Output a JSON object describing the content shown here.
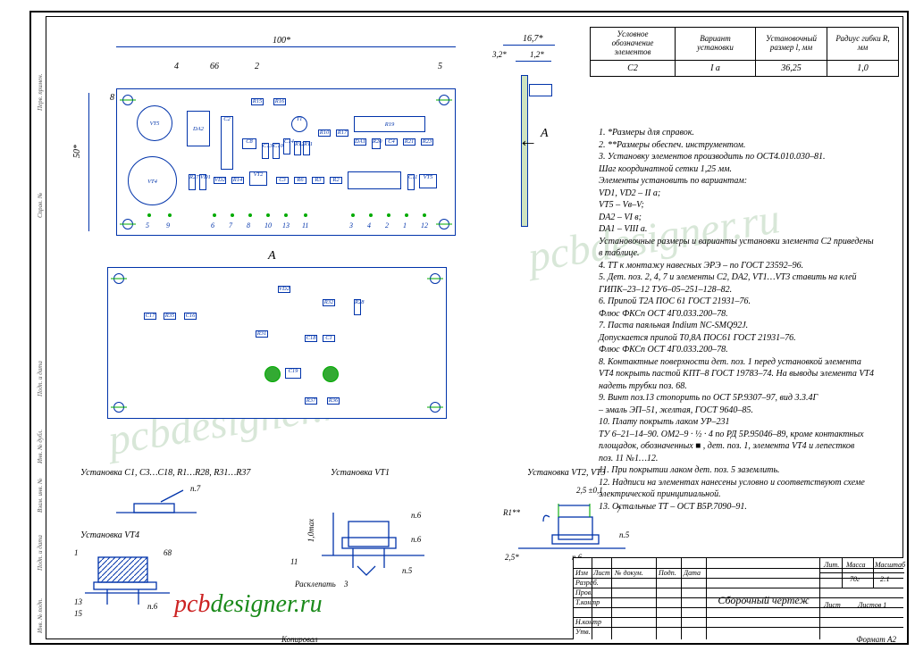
{
  "table": {
    "headers": [
      "Условное обозначение элементов",
      "Вариант установки",
      "Установочный размер l, мм",
      "Радиус гибки R, мм"
    ],
    "row": [
      "C2",
      "I а",
      "36,25",
      "1,0"
    ]
  },
  "dims": {
    "width": "100*",
    "height": "50*",
    "side_w": "16,7*",
    "side_gap": "1,2*",
    "side_t": "3,2*",
    "section": "А",
    "section_full": "А"
  },
  "callouts": {
    "c4": "4",
    "c66": "66",
    "c2": "2",
    "c5": "5",
    "c8": "8"
  },
  "pads_row": [
    "5",
    "9",
    "6",
    "7",
    "8",
    "10",
    "13",
    "11",
    "3",
    "4",
    "2",
    "1",
    "12"
  ],
  "notes": [
    "1.  *Размеры для справок.",
    "2. **Размеры обеспеч. инструментом.",
    "3. Установку элементов производить по ОСТ4.010.030–81.",
    "Шаг координатной сетки 1,25 мм.",
    "Элементы установить по вариантам:",
    "VD1, VD2 – II а;",
    "VT5       – Vв–V;",
    "DA2      – VI в;",
    "DA1      – VIII а.",
    "Установочные размеры и варианты установки элемента С2 приведены",
    "в таблице.",
    "4. ТТ к монтажу навесных ЭРЭ – по ГОСТ 23592–96.",
    "5. Дет. поз. 2, 4, 7 и элементы C2, DA2, VT1…VT3 ставить на клей",
    "ГИПК–23–12  ТУ6–05–251–128–82.",
    "6. Припой Т2А ПОС 61 ГОСТ 21931–76.",
    "Флюс ФКСп ОСТ 4Г0.033.200–78.",
    "7. Паста паяльная Indium NC-SMQ92J.",
    "Допускается припой Т0,8А ПОС61 ГОСТ 21931–76.",
    "Флюс ФКСп ОСТ 4Г0.033.200–78.",
    "8. Контактные поверхности дет. поз. 1 перед установкой элемента",
    "VT4 покрыть пастой КПТ–8 ГОСТ 19783–74. На выводы элемента VT4",
    "надеть трубки поз. 68.",
    "9. Винт поз.13 стопорить по ОСТ 5Р.9307–97, вид 3.3.4Г",
    "– эмаль ЭП–51, желтая, ГОСТ 9640–85.",
    "10. Плату покрыть лаком УР–231",
    "ТУ 6–21–14–90. ОМ2–9 · ½ · 4 по РД 5Р.95046–89, кроме контактных",
    "площадок, обозначенных ■   , дет. поз. 1, элемента VT4 и лепестков",
    "поз. 11 №1…12.",
    "11. При покрытии лаком дет. поз. 5 заземлить.",
    "12. Надписи на элементах нанесены условно и соответствуют схеме",
    "электрической принципиальной.",
    "13. Остальные ТТ – ОСТ В5Р.7090–91."
  ],
  "details": {
    "d1_label": "Установка C1, C3…C18, R1…R28, R31…R37",
    "d1_callout": "п.7",
    "d2_label": "Установка VT4",
    "d2_callouts": {
      "a": "1",
      "b": "68",
      "c": "13",
      "d": "15",
      "e": "п.6"
    },
    "d3_label": "Установка VT1",
    "d3_dim": "1,0max",
    "d3_callouts": {
      "a": "п.6",
      "b": "п.6",
      "c": "п.5",
      "d": "11",
      "e": "3",
      "f": "Расклепать"
    },
    "d4_label": "Установка VT2, VT3",
    "d4_callouts": {
      "a": "R1**",
      "b": "2,5 ±0,1",
      "c": "7",
      "d": "2,5*",
      "e": "п.6",
      "f": "п.5"
    }
  },
  "board": {
    "front": {
      "refs": [
        "VT5",
        "DA2",
        "C2",
        "R15",
        "R16",
        "C8",
        "C13",
        "C10",
        "C14",
        "R12",
        "R11",
        "R10",
        "R17",
        "R19",
        "DA1",
        "R20",
        "C4",
        "R21",
        "R23",
        "R27",
        "VD1",
        "VD2",
        "R14",
        "C3",
        "R6",
        "R3",
        "R2",
        "R1",
        "C9",
        "R7",
        "R5",
        "C11",
        "VT5",
        "VT4",
        "C17",
        "VT2",
        "VT1"
      ]
    },
    "back": {
      "refs": [
        "C17",
        "R35",
        "C16",
        "VD2",
        "R31",
        "R32",
        "R28",
        "C18",
        "C1",
        "R37",
        "R36",
        "C19"
      ]
    }
  },
  "titleblock": {
    "rows_left": [
      "Изм",
      "Лист",
      "№ докум.",
      "Подп.",
      "Дата"
    ],
    "roles": [
      "Разраб.",
      "Пров.",
      "Т.контр",
      "Н.контр",
      "Утв."
    ],
    "title": "Сборочный чертеж",
    "small": [
      "Лит.",
      "Масса",
      "Масштаб"
    ],
    "mass": "70г",
    "scale": "2:1",
    "sheet": "Лист",
    "sheets": "Листов   1",
    "format": "Формат   А2",
    "kopir": "Копировал"
  },
  "left_margin": [
    "Перв. примен.",
    "Справ. №",
    "Подп. и дата",
    "Инв. № дубл.",
    "Взам. инв. №",
    "Подп. и дата",
    "Инв. № подп."
  ],
  "watermark": "pcbdesigner.ru",
  "url": [
    "pcb",
    "designer.ru"
  ]
}
